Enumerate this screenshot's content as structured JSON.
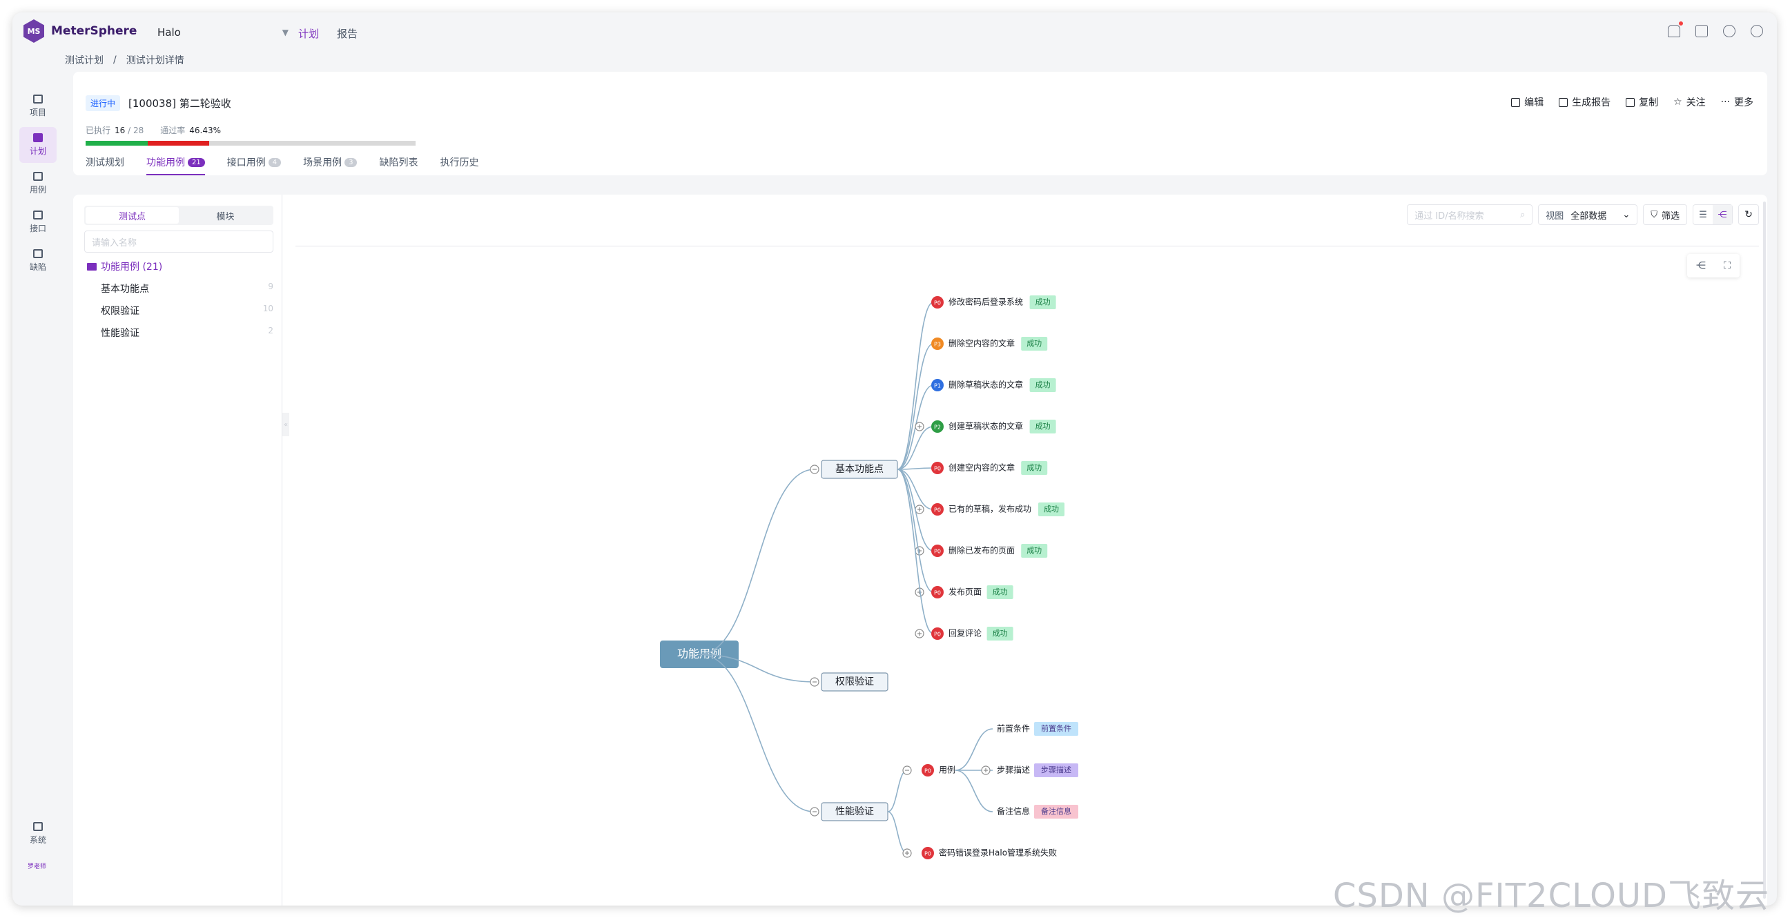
{
  "app": {
    "name": "MeterSphere",
    "logo": "MS",
    "project": "Halo",
    "nav": [
      "计划",
      "报告"
    ],
    "active_nav": "计划"
  },
  "breadcrumb": [
    "测试计划",
    "/",
    "测试计划详情"
  ],
  "sidebar": [
    {
      "label": "项目",
      "icon": "project-icon"
    },
    {
      "label": "计划",
      "icon": "plan-icon",
      "active": true
    },
    {
      "label": "用例",
      "icon": "case-icon"
    },
    {
      "label": "接口",
      "icon": "api-icon"
    },
    {
      "label": "缺陷",
      "icon": "bug-icon"
    },
    {
      "label": "系统",
      "icon": "system-icon"
    }
  ],
  "user": "罗老师",
  "plan": {
    "status": "进行中",
    "title": "[100038] 第二轮验收",
    "executed_label": "已执行",
    "executed": "16",
    "total": "/ 28",
    "pass_label": "通过率",
    "pass_rate": "46.43%",
    "progress": {
      "passed": 0.1875,
      "failed": 0.1875
    }
  },
  "actions": [
    "编辑",
    "生成报告",
    "复制",
    "关注",
    "更多"
  ],
  "tabs": [
    {
      "label": "测试规划",
      "count": ""
    },
    {
      "label": "功能用例",
      "count": "21",
      "active": true
    },
    {
      "label": "接口用例",
      "count": "4"
    },
    {
      "label": "场景用例",
      "count": "3"
    },
    {
      "label": "缺陷列表",
      "count": ""
    },
    {
      "label": "执行历史",
      "count": ""
    }
  ],
  "left": {
    "seg": [
      "测试点",
      "模块"
    ],
    "search_placeholder": "请输入名称",
    "folder": "功能用例 (21)",
    "modules": [
      {
        "name": "基本功能点",
        "count": "9"
      },
      {
        "name": "权限验证",
        "count": "10"
      },
      {
        "name": "性能验证",
        "count": "2"
      }
    ]
  },
  "toolbar": {
    "search_placeholder": "通过 ID/名称搜索",
    "view_label": "视图",
    "view_value": "全部数据",
    "filter": "筛选"
  },
  "mindmap": {
    "root": "功能用例",
    "branches": [
      "基本功能点",
      "权限验证",
      "性能验证"
    ],
    "cases": [
      {
        "pri": "P0",
        "name": "修改密码后登录系统",
        "result": "成功"
      },
      {
        "pri": "P3",
        "name": "删除空内容的文章",
        "result": "成功"
      },
      {
        "pri": "P1",
        "name": "删除草稿状态的文章",
        "result": "成功"
      },
      {
        "pri": "P2",
        "name": "创建草稿状态的文章",
        "result": "成功"
      },
      {
        "pri": "P0",
        "name": "创建空内容的文章",
        "result": "成功"
      },
      {
        "pri": "P0",
        "name": "已有的草稿，发布成功",
        "result": "成功"
      },
      {
        "pri": "P0",
        "name": "删除已发布的页面",
        "result": "成功"
      },
      {
        "pri": "P0",
        "name": "发布页面",
        "result": "成功"
      },
      {
        "pri": "P0",
        "name": "回复评论",
        "result": "成功"
      }
    ],
    "perf_case": {
      "pri": "P0",
      "name": "用例",
      "fields": [
        {
          "label": "前置条件",
          "tag": "前置条件",
          "color": "#bfe3fb"
        },
        {
          "label": "步骤描述",
          "tag": "步骤描述",
          "color": "#c7b8f5"
        },
        {
          "label": "备注信息",
          "tag": "备注信息",
          "color": "#f8c3cf"
        }
      ]
    },
    "perf_case2": {
      "pri": "P0",
      "name": "密码错误登录Halo管理系统失败"
    }
  },
  "colors": {
    "accent": "#7b2fbd",
    "p0": "#e0353b",
    "p1": "#2f6fe0",
    "p2": "#2e9d45",
    "p3": "#f08a24",
    "success_tag": "#b7f0d0",
    "root": "#6a9ab8"
  },
  "watermark": "CSDN @FIT2CLOUD飞致云"
}
